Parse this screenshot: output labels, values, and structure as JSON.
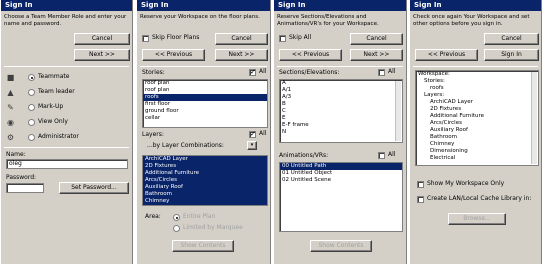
{
  "panel1": {
    "title": "Sign In",
    "desc": "Choose a Team Member Role and enter your name and password.",
    "cancel": "Cancel",
    "next": "Next >>",
    "roles": [
      "Teammate",
      "Team leader",
      "Mark-Up",
      "View Only",
      "Administrator"
    ],
    "name_label": "Name:",
    "name_value": "oleg",
    "password_label": "Password:",
    "set_password": "Set Password..."
  },
  "panel2": {
    "title": "Sign In",
    "desc": "Reserve your Workspace on the floor plans.",
    "skip": "Skip Floor Plans",
    "cancel": "Cancel",
    "prev": "<< Previous",
    "next": "Next >>",
    "stories_label": "Stories:",
    "all": "All",
    "stories": [
      "roof plan",
      "roof plan",
      "roofs",
      "first floor",
      "ground floor",
      "cellar"
    ],
    "layers_label": "Layers:",
    "by_layer_combo": "...by Layer Combinations:",
    "layers": [
      "ArchiCAD Layer",
      "2D Fixtures",
      "Additional Furniture",
      "Arcs/Circles",
      "Auxiliary Roof",
      "Bathroom",
      "Chimney"
    ],
    "area_label": "Area:",
    "entire_plan": "Entire Plan",
    "limited_by_marquee": "Limited by Marquee",
    "show_contents": "Show Contents"
  },
  "panel3": {
    "title": "Sign In",
    "desc": "Reserve Sections/Elevations and Animations/VR's for your Workspace.",
    "skip": "Skip All",
    "cancel": "Cancel",
    "prev": "<< Previous",
    "next": "Next >>",
    "sections_label": "Sections/Elevations:",
    "all": "All",
    "sections": [
      "A",
      "A/1",
      "A/3",
      "B",
      "C",
      "E",
      "E-F frame",
      "N"
    ],
    "anim_label": "Animations/VRs:",
    "animations": [
      "00  Untitled Path",
      "01  Untitled Object",
      "02  Untitled Scene"
    ],
    "show_contents": "Show Contents"
  },
  "panel4": {
    "title": "Sign In",
    "desc": "Check once again Your Workspace and set other options before you sign in.",
    "cancel": "Cancel",
    "prev": "<< Previous",
    "sign_in": "Sign In",
    "workspace_label": "Workspace:",
    "workspace_tree": [
      {
        "text": "Stories:",
        "level": 1
      },
      {
        "text": "roofs",
        "level": 2
      },
      {
        "text": "Layers:",
        "level": 1
      },
      {
        "text": "ArchiCAD Layer",
        "level": 2
      },
      {
        "text": "2D Fixtures",
        "level": 2
      },
      {
        "text": "Additional Furniture",
        "level": 2
      },
      {
        "text": "Arcs/Circles",
        "level": 2
      },
      {
        "text": "Auxiliary Roof",
        "level": 2
      },
      {
        "text": "Bathroom",
        "level": 2
      },
      {
        "text": "Chimney",
        "level": 2
      },
      {
        "text": "Dimensioning",
        "level": 2
      },
      {
        "text": "Electrical",
        "level": 2
      }
    ],
    "show_only": "Show My Workspace Only",
    "create_cache": "Create LAN/Local Cache Library in:",
    "browse": "Browse..."
  },
  "colors": {
    "panel_bg": "#d4d0c8",
    "title_bg": "#0a246a",
    "selection": "#0a246a"
  }
}
